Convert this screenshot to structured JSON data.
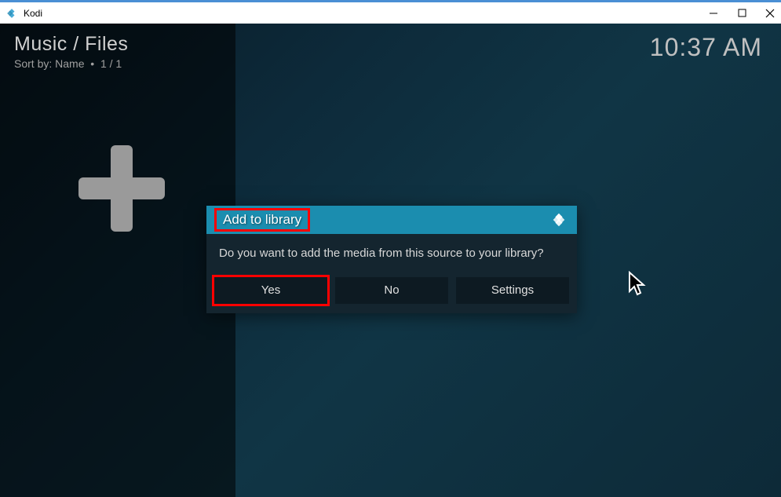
{
  "window": {
    "title": "Kodi"
  },
  "header": {
    "breadcrumb": "Music / Files",
    "sort": "Sort by: Name",
    "page": "1 / 1",
    "clock": "10:37 AM"
  },
  "dialog": {
    "title": "Add to library",
    "message": "Do you want to add the media from this source to your library?",
    "buttons": {
      "yes": "Yes",
      "no": "No",
      "settings": "Settings"
    }
  }
}
